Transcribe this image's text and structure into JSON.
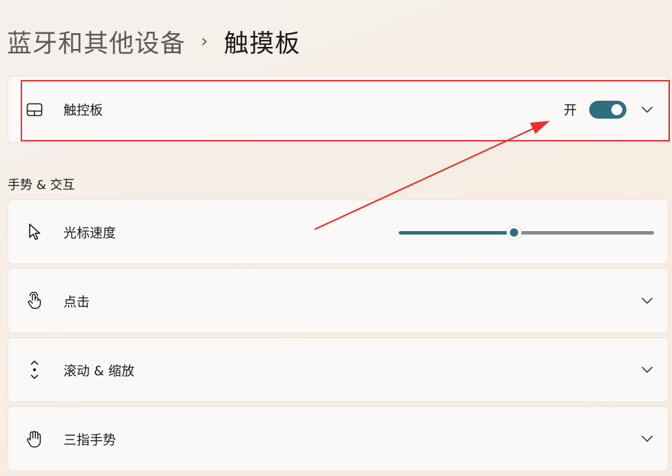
{
  "breadcrumb": {
    "parent": "蓝牙和其他设备",
    "separator": "›",
    "current": "触摸板"
  },
  "touchpad": {
    "label": "触控板",
    "toggle_text": "开",
    "toggle_on": true,
    "icon": "touchpad-icon"
  },
  "section": {
    "title": "手势 & 交互"
  },
  "rows": [
    {
      "label": "光标速度",
      "icon": "cursor-icon",
      "kind": "slider",
      "value_percent": 45
    },
    {
      "label": "点击",
      "icon": "tap-icon",
      "kind": "expander"
    },
    {
      "label": "滚动 & 缩放",
      "icon": "scroll-icon",
      "kind": "expander"
    },
    {
      "label": "三指手势",
      "icon": "hand-icon",
      "kind": "expander"
    }
  ],
  "colors": {
    "accent": "#2f6e7f",
    "annotation": "#e8302c",
    "card": "#fbf9f7"
  }
}
